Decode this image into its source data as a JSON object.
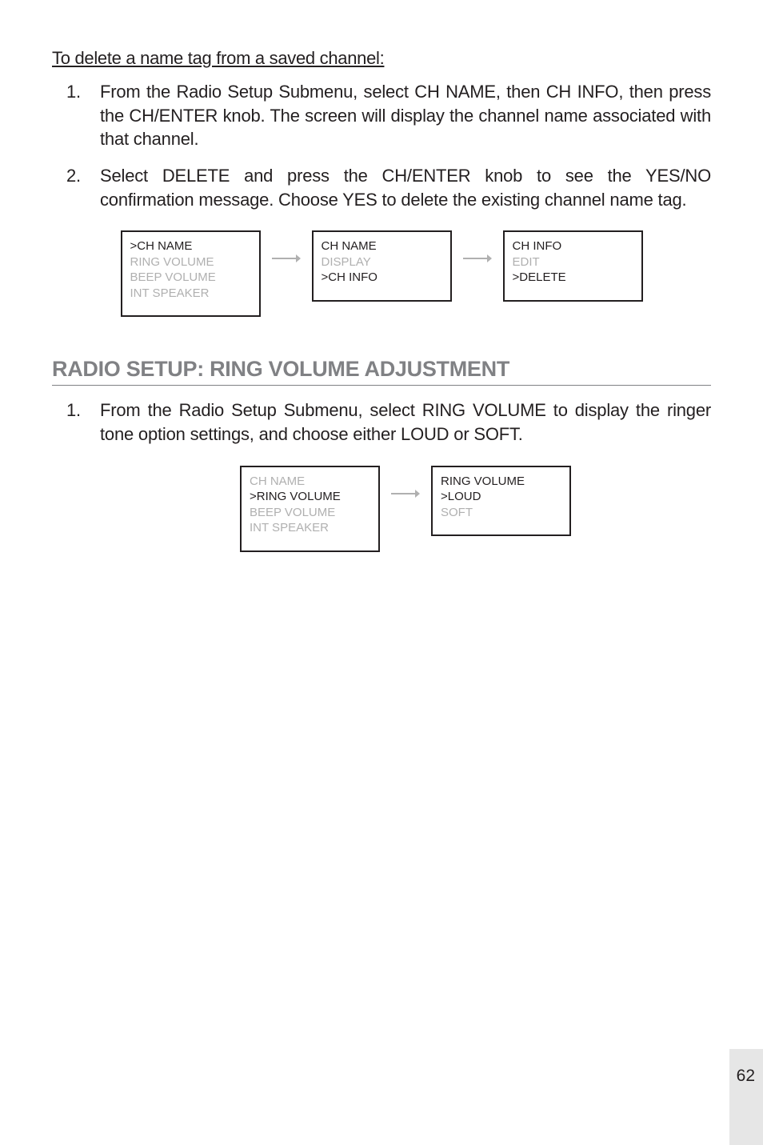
{
  "subheading": "To delete a name tag from a saved channel:",
  "steps_delete": [
    "From the Radio Setup Submenu, select CH NAME, then CH INFO, then press the CH/ENTER knob. The screen will display the channel name associated with that channel.",
    "Select DELETE and press the CH/ENTER knob to see the YES/NO confirmation message. Choose YES to delete the existing channel name tag."
  ],
  "diagram1": {
    "screen1": [
      {
        "t": ">CH NAME",
        "c": "norm"
      },
      {
        "t": "RING VOLUME",
        "c": "dim"
      },
      {
        "t": "BEEP VOLUME",
        "c": "dim"
      },
      {
        "t": "INT SPEAKER",
        "c": "dim"
      }
    ],
    "screen2": [
      {
        "t": "CH NAME",
        "c": "norm"
      },
      {
        "t": "DISPLAY",
        "c": "dim"
      },
      {
        "t": ">CH INFO",
        "c": "norm"
      }
    ],
    "screen3": [
      {
        "t": "CH INFO",
        "c": "norm"
      },
      {
        "t": "EDIT",
        "c": "dim"
      },
      {
        "t": ">DELETE",
        "c": "norm"
      }
    ]
  },
  "section_title": "RADIO SETUP: RING VOLUME ADJUSTMENT",
  "steps_ring": [
    "From the Radio Setup Submenu, select RING VOLUME to display the ringer tone option settings, and choose either LOUD or SOFT."
  ],
  "diagram2": {
    "screen1": [
      {
        "t": "CH NAME",
        "c": "dim"
      },
      {
        "t": ">RING VOLUME",
        "c": "norm"
      },
      {
        "t": "BEEP VOLUME",
        "c": "dim"
      },
      {
        "t": "INT SPEAKER",
        "c": "dim"
      }
    ],
    "screen2": [
      {
        "t": "RING VOLUME",
        "c": "norm"
      },
      {
        "t": ">LOUD",
        "c": "norm"
      },
      {
        "t": "SOFT",
        "c": "dim"
      }
    ]
  },
  "page_number": "62"
}
